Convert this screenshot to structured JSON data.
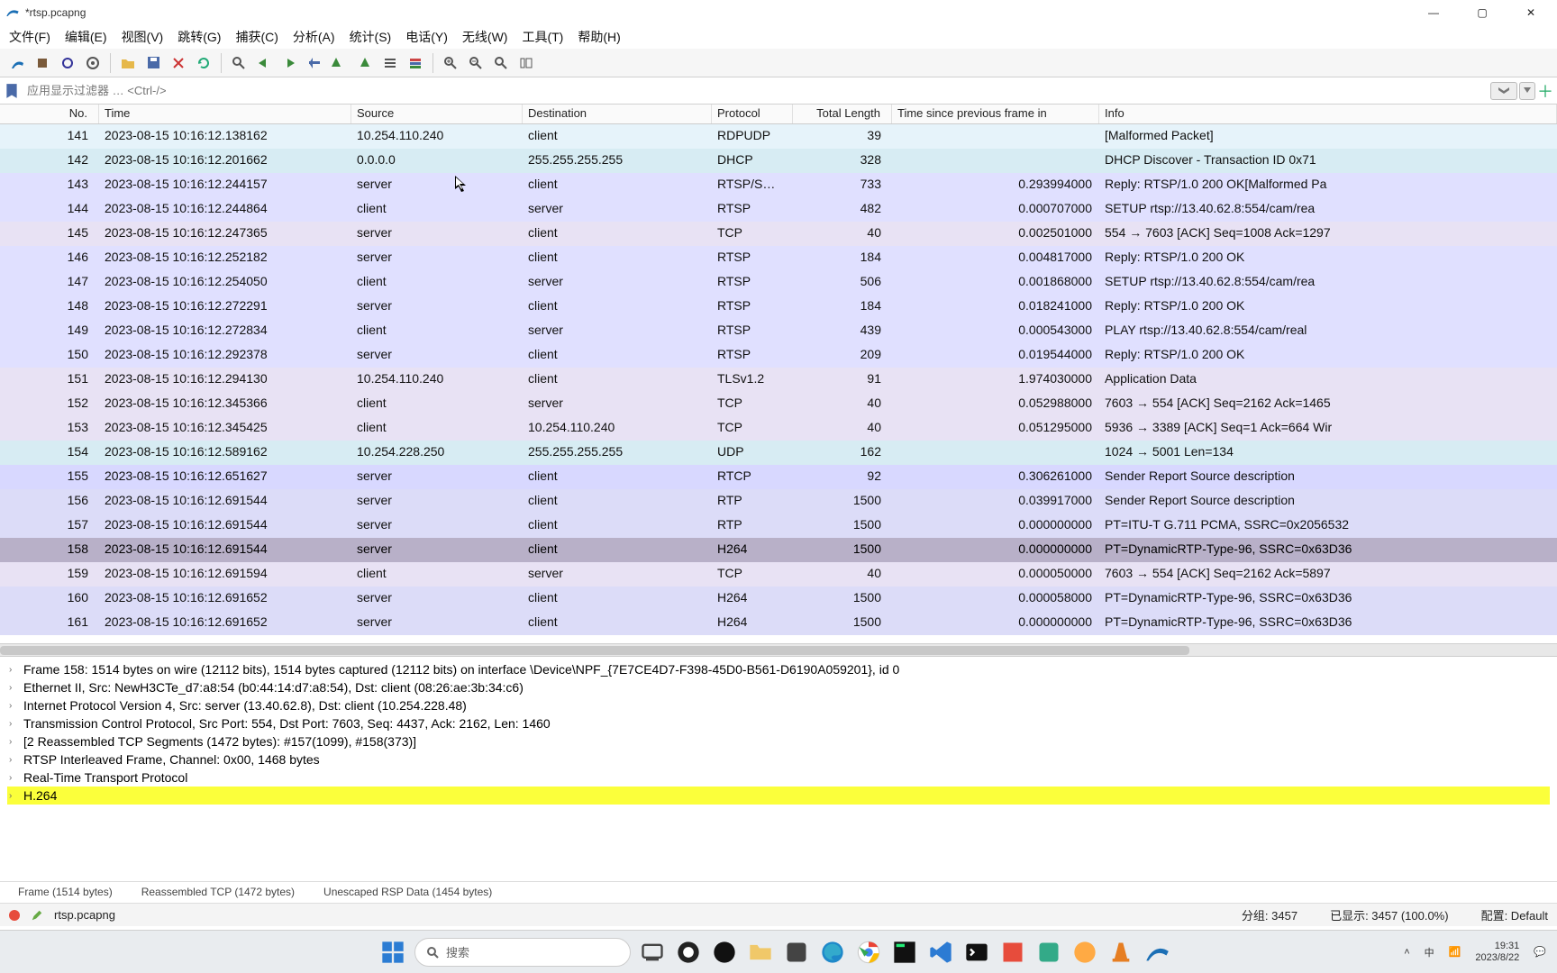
{
  "window": {
    "title": "*rtsp.pcapng"
  },
  "menu": {
    "file": "文件(F)",
    "edit": "编辑(E)",
    "view": "视图(V)",
    "go": "跳转(G)",
    "capture": "捕获(C)",
    "analyze": "分析(A)",
    "stats": "统计(S)",
    "tel": "电话(Y)",
    "wireless": "无线(W)",
    "tools": "工具(T)",
    "help": "帮助(H)"
  },
  "filter": {
    "placeholder": "应用显示过滤器 … <Ctrl-/>"
  },
  "columns": {
    "no": "No.",
    "time": "Time",
    "src": "Source",
    "dst": "Destination",
    "proto": "Protocol",
    "len": "Total Length",
    "delta": "Time since previous frame in",
    "info": "Info"
  },
  "packets": [
    {
      "no": "141",
      "time": "2023-08-15 10:16:12.138162",
      "src": "10.254.110.240",
      "dst": "client",
      "proto": "RDPUDP",
      "len": "39",
      "delta": "",
      "info": "[Malformed Packet]",
      "cls": "bg-rdp"
    },
    {
      "no": "142",
      "time": "2023-08-15 10:16:12.201662",
      "src": "0.0.0.0",
      "dst": "255.255.255.255",
      "proto": "DHCP",
      "len": "328",
      "delta": "",
      "info": "DHCP Discover - Transaction ID 0x71",
      "cls": "bg-dhcp"
    },
    {
      "no": "143",
      "time": "2023-08-15 10:16:12.244157",
      "src": "server",
      "dst": "client",
      "proto": "RTSP/S…",
      "len": "733",
      "delta": "0.293994000",
      "info": "Reply: RTSP/1.0 200 OK[Malformed Pa",
      "cls": "bg-rtsp"
    },
    {
      "no": "144",
      "time": "2023-08-15 10:16:12.244864",
      "src": "client",
      "dst": "server",
      "proto": "RTSP",
      "len": "482",
      "delta": "0.000707000",
      "info": "SETUP rtsp://13.40.62.8:554/cam/rea",
      "cls": "bg-rtsp"
    },
    {
      "no": "145",
      "time": "2023-08-15 10:16:12.247365",
      "src": "server",
      "dst": "client",
      "proto": "TCP",
      "len": "40",
      "delta": "0.002501000",
      "info": "554 → 7603 [ACK] Seq=1008 Ack=1297",
      "cls": "bg-tcp"
    },
    {
      "no": "146",
      "time": "2023-08-15 10:16:12.252182",
      "src": "server",
      "dst": "client",
      "proto": "RTSP",
      "len": "184",
      "delta": "0.004817000",
      "info": "Reply: RTSP/1.0 200 OK",
      "cls": "bg-rtsp"
    },
    {
      "no": "147",
      "time": "2023-08-15 10:16:12.254050",
      "src": "client",
      "dst": "server",
      "proto": "RTSP",
      "len": "506",
      "delta": "0.001868000",
      "info": "SETUP rtsp://13.40.62.8:554/cam/rea",
      "cls": "bg-rtsp"
    },
    {
      "no": "148",
      "time": "2023-08-15 10:16:12.272291",
      "src": "server",
      "dst": "client",
      "proto": "RTSP",
      "len": "184",
      "delta": "0.018241000",
      "info": "Reply: RTSP/1.0 200 OK",
      "cls": "bg-rtsp"
    },
    {
      "no": "149",
      "time": "2023-08-15 10:16:12.272834",
      "src": "client",
      "dst": "server",
      "proto": "RTSP",
      "len": "439",
      "delta": "0.000543000",
      "info": "PLAY rtsp://13.40.62.8:554/cam/real",
      "cls": "bg-rtsp"
    },
    {
      "no": "150",
      "time": "2023-08-15 10:16:12.292378",
      "src": "server",
      "dst": "client",
      "proto": "RTSP",
      "len": "209",
      "delta": "0.019544000",
      "info": "Reply: RTSP/1.0 200 OK",
      "cls": "bg-rtsp"
    },
    {
      "no": "151",
      "time": "2023-08-15 10:16:12.294130",
      "src": "10.254.110.240",
      "dst": "client",
      "proto": "TLSv1.2",
      "len": "91",
      "delta": "1.974030000",
      "info": "Application Data",
      "cls": "bg-tls"
    },
    {
      "no": "152",
      "time": "2023-08-15 10:16:12.345366",
      "src": "client",
      "dst": "server",
      "proto": "TCP",
      "len": "40",
      "delta": "0.052988000",
      "info": "7603 → 554 [ACK] Seq=2162 Ack=1465",
      "cls": "bg-tcp"
    },
    {
      "no": "153",
      "time": "2023-08-15 10:16:12.345425",
      "src": "client",
      "dst": "10.254.110.240",
      "proto": "TCP",
      "len": "40",
      "delta": "0.051295000",
      "info": "5936 → 3389 [ACK] Seq=1 Ack=664 Wir",
      "cls": "bg-tcp"
    },
    {
      "no": "154",
      "time": "2023-08-15 10:16:12.589162",
      "src": "10.254.228.250",
      "dst": "255.255.255.255",
      "proto": "UDP",
      "len": "162",
      "delta": "",
      "info": "1024 → 5001 Len=134",
      "cls": "bg-udp"
    },
    {
      "no": "155",
      "time": "2023-08-15 10:16:12.651627",
      "src": "server",
      "dst": "client",
      "proto": "RTCP",
      "len": "92",
      "delta": "0.306261000",
      "info": "Sender Report   Source description",
      "cls": "bg-rtcp"
    },
    {
      "no": "156",
      "time": "2023-08-15 10:16:12.691544",
      "src": "server",
      "dst": "client",
      "proto": "RTP",
      "len": "1500",
      "delta": "0.039917000",
      "info": "Sender Report   Source description",
      "cls": "bg-rtp"
    },
    {
      "no": "157",
      "time": "2023-08-15 10:16:12.691544",
      "src": "server",
      "dst": "client",
      "proto": "RTP",
      "len": "1500",
      "delta": "0.000000000",
      "info": "PT=ITU-T G.711 PCMA, SSRC=0x2056532",
      "cls": "bg-rtp"
    },
    {
      "no": "158",
      "time": "2023-08-15 10:16:12.691544",
      "src": "server",
      "dst": "client",
      "proto": "H264",
      "len": "1500",
      "delta": "0.000000000",
      "info": "PT=DynamicRTP-Type-96, SSRC=0x63D36",
      "cls": "bg-sel"
    },
    {
      "no": "159",
      "time": "2023-08-15 10:16:12.691594",
      "src": "client",
      "dst": "server",
      "proto": "TCP",
      "len": "40",
      "delta": "0.000050000",
      "info": "7603 → 554 [ACK] Seq=2162 Ack=5897",
      "cls": "bg-tcp"
    },
    {
      "no": "160",
      "time": "2023-08-15 10:16:12.691652",
      "src": "server",
      "dst": "client",
      "proto": "H264",
      "len": "1500",
      "delta": "0.000058000",
      "info": "PT=DynamicRTP-Type-96, SSRC=0x63D36",
      "cls": "bg-h264"
    },
    {
      "no": "161",
      "time": "2023-08-15 10:16:12.691652",
      "src": "server",
      "dst": "client",
      "proto": "H264",
      "len": "1500",
      "delta": "0.000000000",
      "info": "PT=DynamicRTP-Type-96, SSRC=0x63D36",
      "cls": "bg-h264"
    }
  ],
  "detail": {
    "l0": "Frame 158: 1514 bytes on wire (12112 bits), 1514 bytes captured (12112 bits) on interface \\Device\\NPF_{7E7CE4D7-F398-45D0-B561-D6190A059201}, id 0",
    "l1": "Ethernet II, Src: NewH3CTe_d7:a8:54 (b0:44:14:d7:a8:54), Dst: client (08:26:ae:3b:34:c6)",
    "l2": "Internet Protocol Version 4, Src: server (13.40.62.8), Dst: client (10.254.228.48)",
    "l3": "Transmission Control Protocol, Src Port: 554, Dst Port: 7603, Seq: 4437, Ack: 2162, Len: 1460",
    "l4": "[2 Reassembled TCP Segments (1472 bytes): #157(1099), #158(373)]",
    "l5": "RTSP Interleaved Frame, Channel: 0x00, 1468 bytes",
    "l6": "Real-Time Transport Protocol",
    "l7": "H.264"
  },
  "tabs": {
    "t0": "Frame (1514 bytes)",
    "t1": "Reassembled TCP (1472 bytes)",
    "t2": "Unescaped RSP Data (1454 bytes)"
  },
  "statusbar": {
    "file": "rtsp.pcapng",
    "pkts": "分组: 3457",
    "disp": "已显示: 3457 (100.0%)",
    "profile": "配置: Default"
  },
  "taskbar": {
    "search": "搜索",
    "time": "19:31",
    "date": "2023/8/22"
  }
}
